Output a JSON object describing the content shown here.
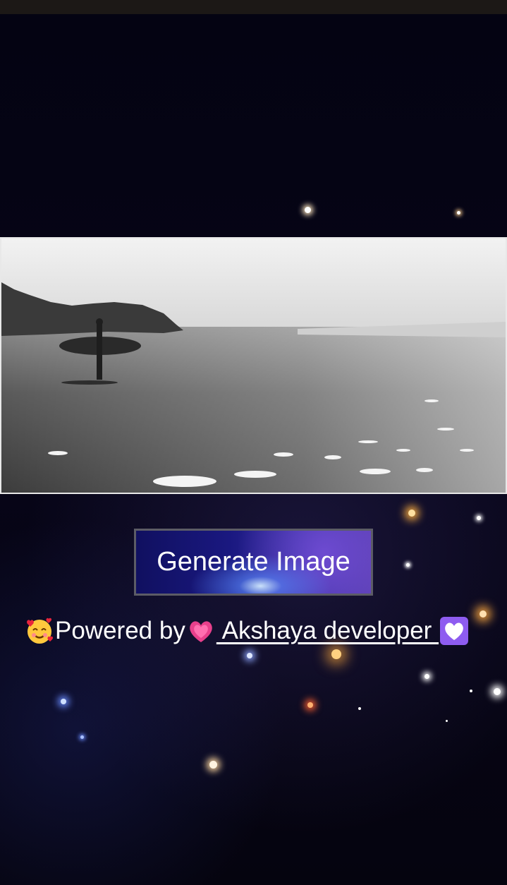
{
  "generate_button": {
    "label": "Generate Image"
  },
  "credit": {
    "prefix_emoji": "smiling-face-with-hearts-icon",
    "text": "Powered by ",
    "link": {
      "heart_emoji": "growing-heart-icon",
      "label": " Akshaya developer ",
      "trailing_emoji": "white-heart-icon"
    }
  },
  "colors": {
    "status_bar": "#1c1816",
    "background": "#05040f",
    "button_border": "#5c5c66",
    "text": "#ffffff"
  }
}
